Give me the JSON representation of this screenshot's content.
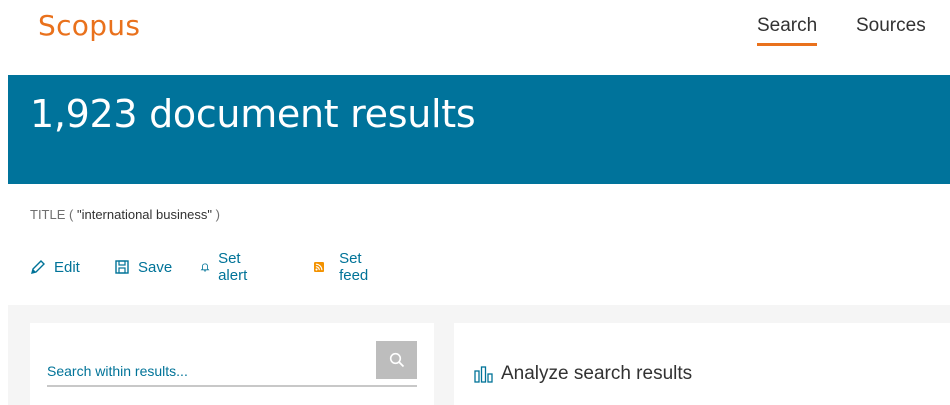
{
  "header": {
    "logo": "Scopus",
    "nav": {
      "search": "Search",
      "sources": "Sources"
    }
  },
  "results": {
    "title": "1,923 document results"
  },
  "query": {
    "field": "TITLE",
    "open": " ( ",
    "term": "\"international business\"",
    "close": " )"
  },
  "actions": {
    "edit": "Edit",
    "save": "Save",
    "alert": "Set alert",
    "feed": "Set feed"
  },
  "search_within": {
    "placeholder": "Search within results..."
  },
  "analyze": {
    "label": "Analyze search results"
  },
  "colors": {
    "brand_orange": "#e9711c",
    "band_blue": "#00739b",
    "link_blue": "#007398"
  }
}
